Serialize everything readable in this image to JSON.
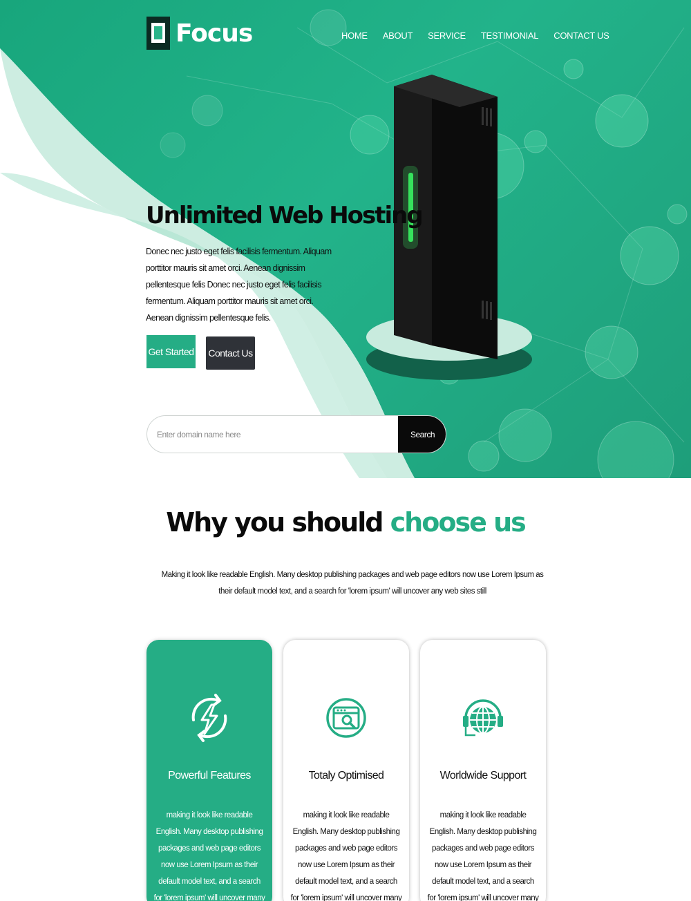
{
  "brand": {
    "name": "Focus"
  },
  "nav": {
    "items": [
      "HOME",
      "ABOUT",
      "SERVICE",
      "TESTIMONIAL",
      "CONTACT US"
    ]
  },
  "hero": {
    "title": "Unlimited Web Hosting",
    "description": "Donec nec justo eget felis facilisis fermentum. Aliquam porttitor mauris sit amet orci. Aenean dignissim pellentesque felis Donec nec justo eget felis facilisis fermentum. Aliquam porttitor mauris sit amet orci. Aenean dignissim pellentesque felis.",
    "get_started": "Get Started",
    "contact_us": "Contact Us"
  },
  "search": {
    "placeholder": "Enter domain name here",
    "button": "Search"
  },
  "why": {
    "title_part1": "Why you should",
    "title_part2": "choose us",
    "description": "Making it look like readable English. Many desktop publishing packages and web page editors now use Lorem Ipsum as their default model text, and a search for 'lorem ipsum' will uncover any web sites still"
  },
  "cards": [
    {
      "title": "Powerful Features",
      "text": "making it look like readable English. Many desktop publishing packages and web page editors now use Lorem Ipsum as their default model text, and a search for 'lorem ipsum' will uncover many web sites still",
      "icon": "lightning-refresh-icon"
    },
    {
      "title": "Totaly Optimised",
      "text": "making it look like readable English. Many desktop publishing packages and web page editors now use Lorem Ipsum as their default model text, and a search for 'lorem ipsum' will uncover many web sites still",
      "icon": "browser-search-icon"
    },
    {
      "title": "Worldwide Support",
      "text": "making it look like readable English. Many desktop publishing packages and web page editors now use Lorem Ipsum as their default model text, and a search for 'lorem ipsum' will uncover many web sites still",
      "icon": "globe-support-icon"
    }
  ],
  "colors": {
    "accent": "#25ad85",
    "dark_button": "#2f3238",
    "search_button": "#0a0a0a"
  }
}
